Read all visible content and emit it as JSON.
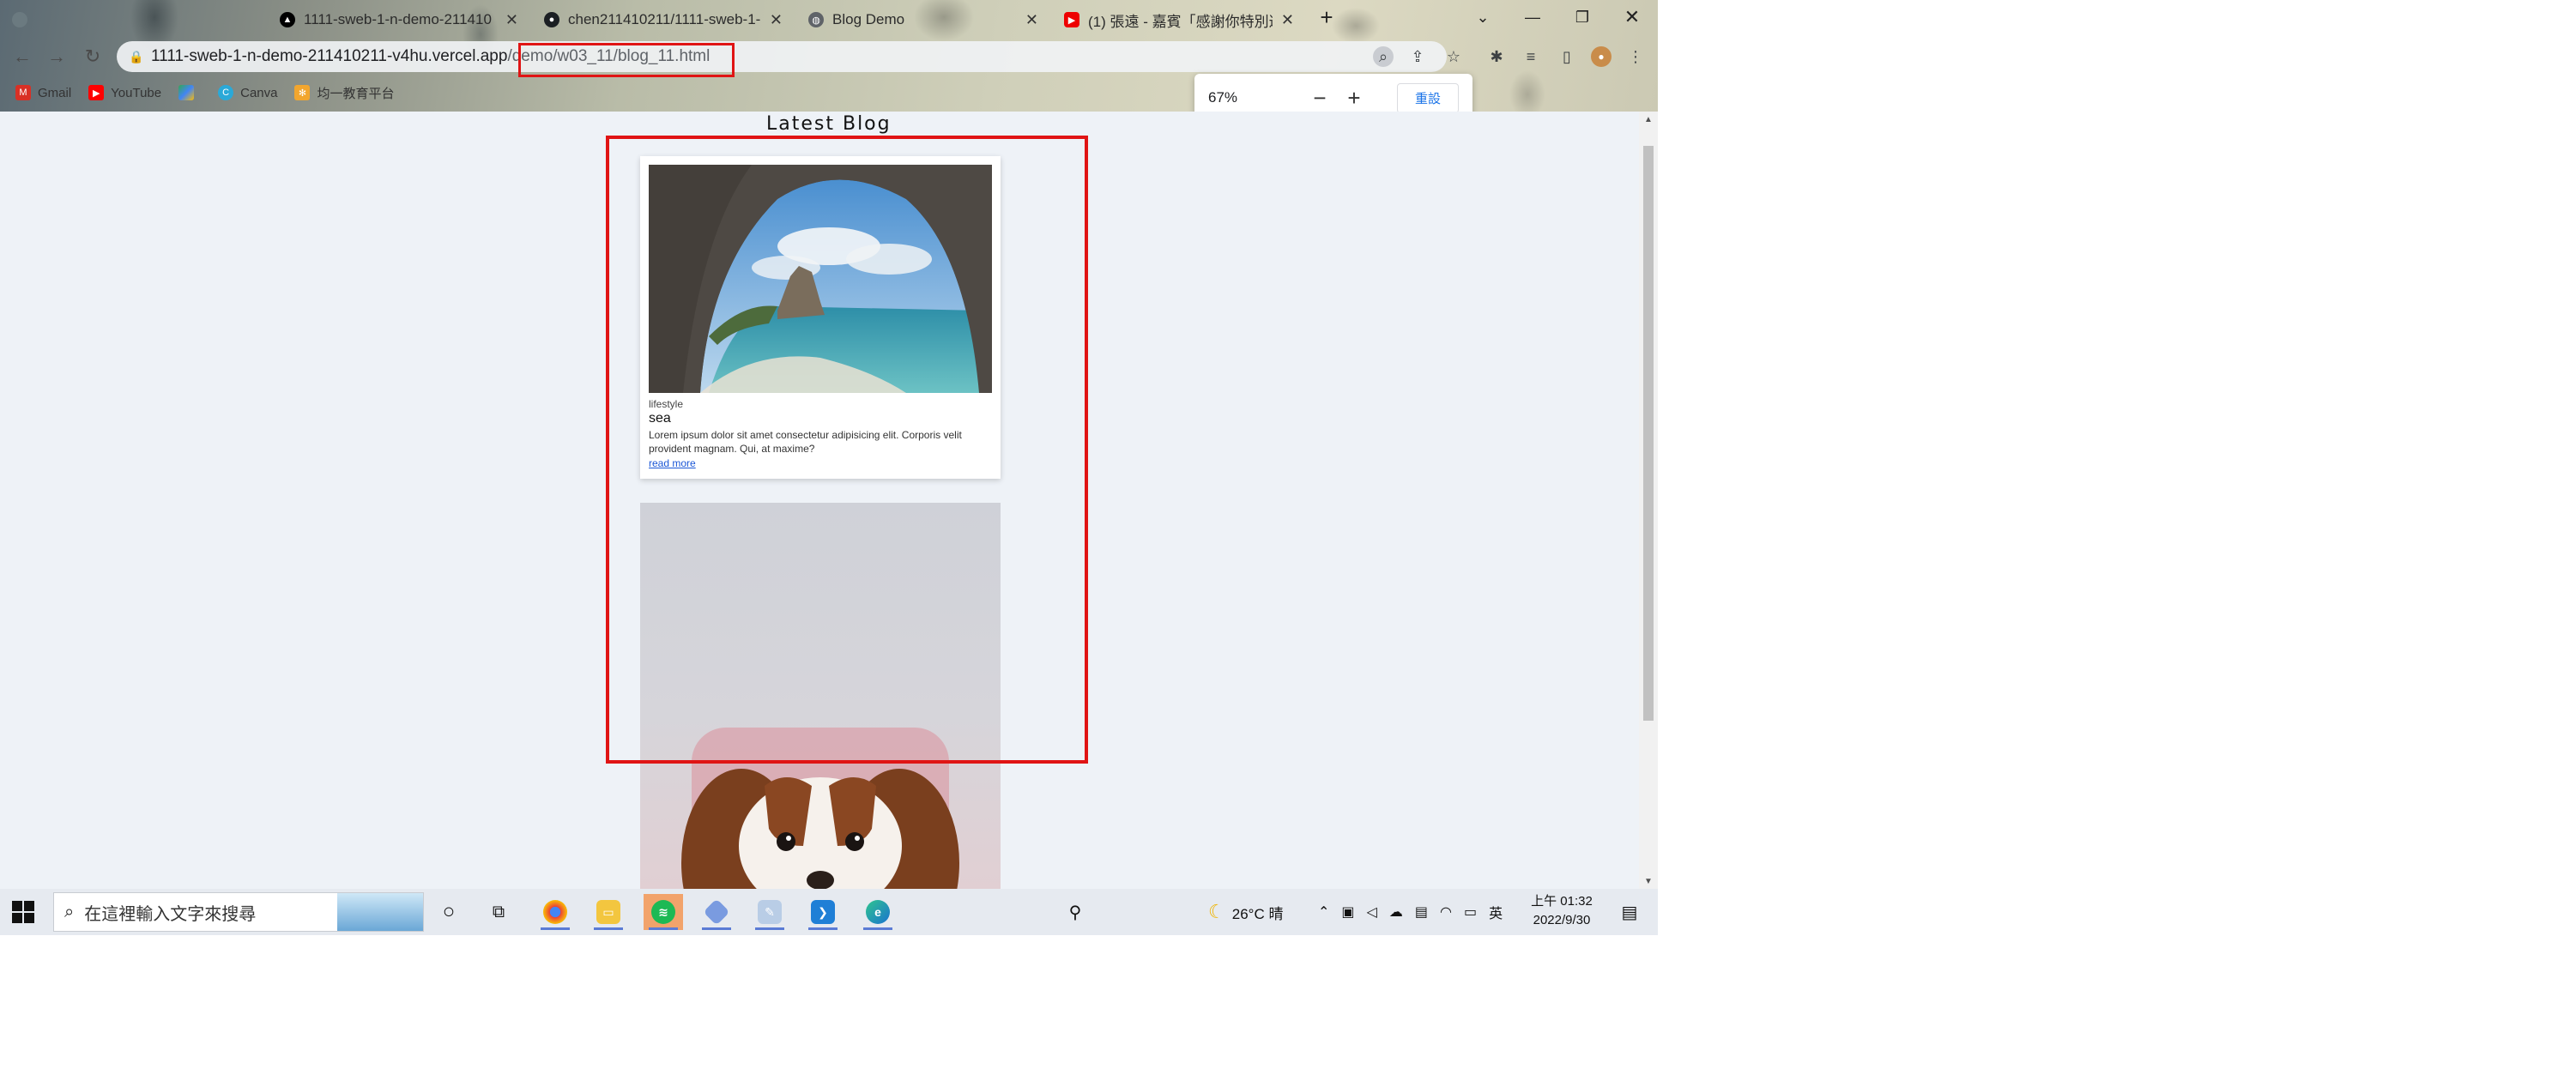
{
  "browser": {
    "tabs": [
      {
        "label": "",
        "favicon": "blurred"
      },
      {
        "label": "1111-sweb-1-n-demo-211410",
        "favicon": "vercel-triangle"
      },
      {
        "label": "chen211410211/1111-sweb-1-",
        "favicon": "github"
      },
      {
        "label": "Blog Demo",
        "favicon": "globe",
        "active": true
      },
      {
        "label": "(1) 張遠 - 嘉賓「感謝你特別邀",
        "favicon": "youtube"
      }
    ],
    "url": {
      "host": "1111-sweb-1-n-demo-211410211-v4hu.vercel.app",
      "path": "/demo/w03_11/blog_11.html"
    },
    "bookmarks": [
      {
        "label": "Gmail",
        "icon": "gmail-icon"
      },
      {
        "label": "YouTube",
        "icon": "youtube-icon"
      },
      {
        "label": "",
        "icon": "maps-icon"
      },
      {
        "label": "Canva",
        "icon": "canva-icon"
      },
      {
        "label": "均一教育平台",
        "icon": "junyi-icon"
      }
    ],
    "zoom_popup": {
      "percent": "67%",
      "minus": "−",
      "plus": "+",
      "reset": "重設"
    }
  },
  "page": {
    "heading": "Latest Blog",
    "cards": [
      {
        "image": "sea-cave",
        "category": "lifestyle",
        "title": "sea",
        "text": "Lorem ipsum dolor sit amet consectetur adipisicing elit. Corporis velit provident magnam. Qui, at maxime?",
        "link": "read more"
      },
      {
        "image": "dog"
      }
    ]
  },
  "taskbar": {
    "search_placeholder": "在這裡輸入文字來搜尋",
    "weather": "26°C 晴",
    "ime": "英",
    "time": "上午 01:32",
    "date": "2022/9/30"
  },
  "colors": {
    "highlight": "#e01414",
    "link": "#1a56d6",
    "page_bg": "#eef2f7"
  }
}
